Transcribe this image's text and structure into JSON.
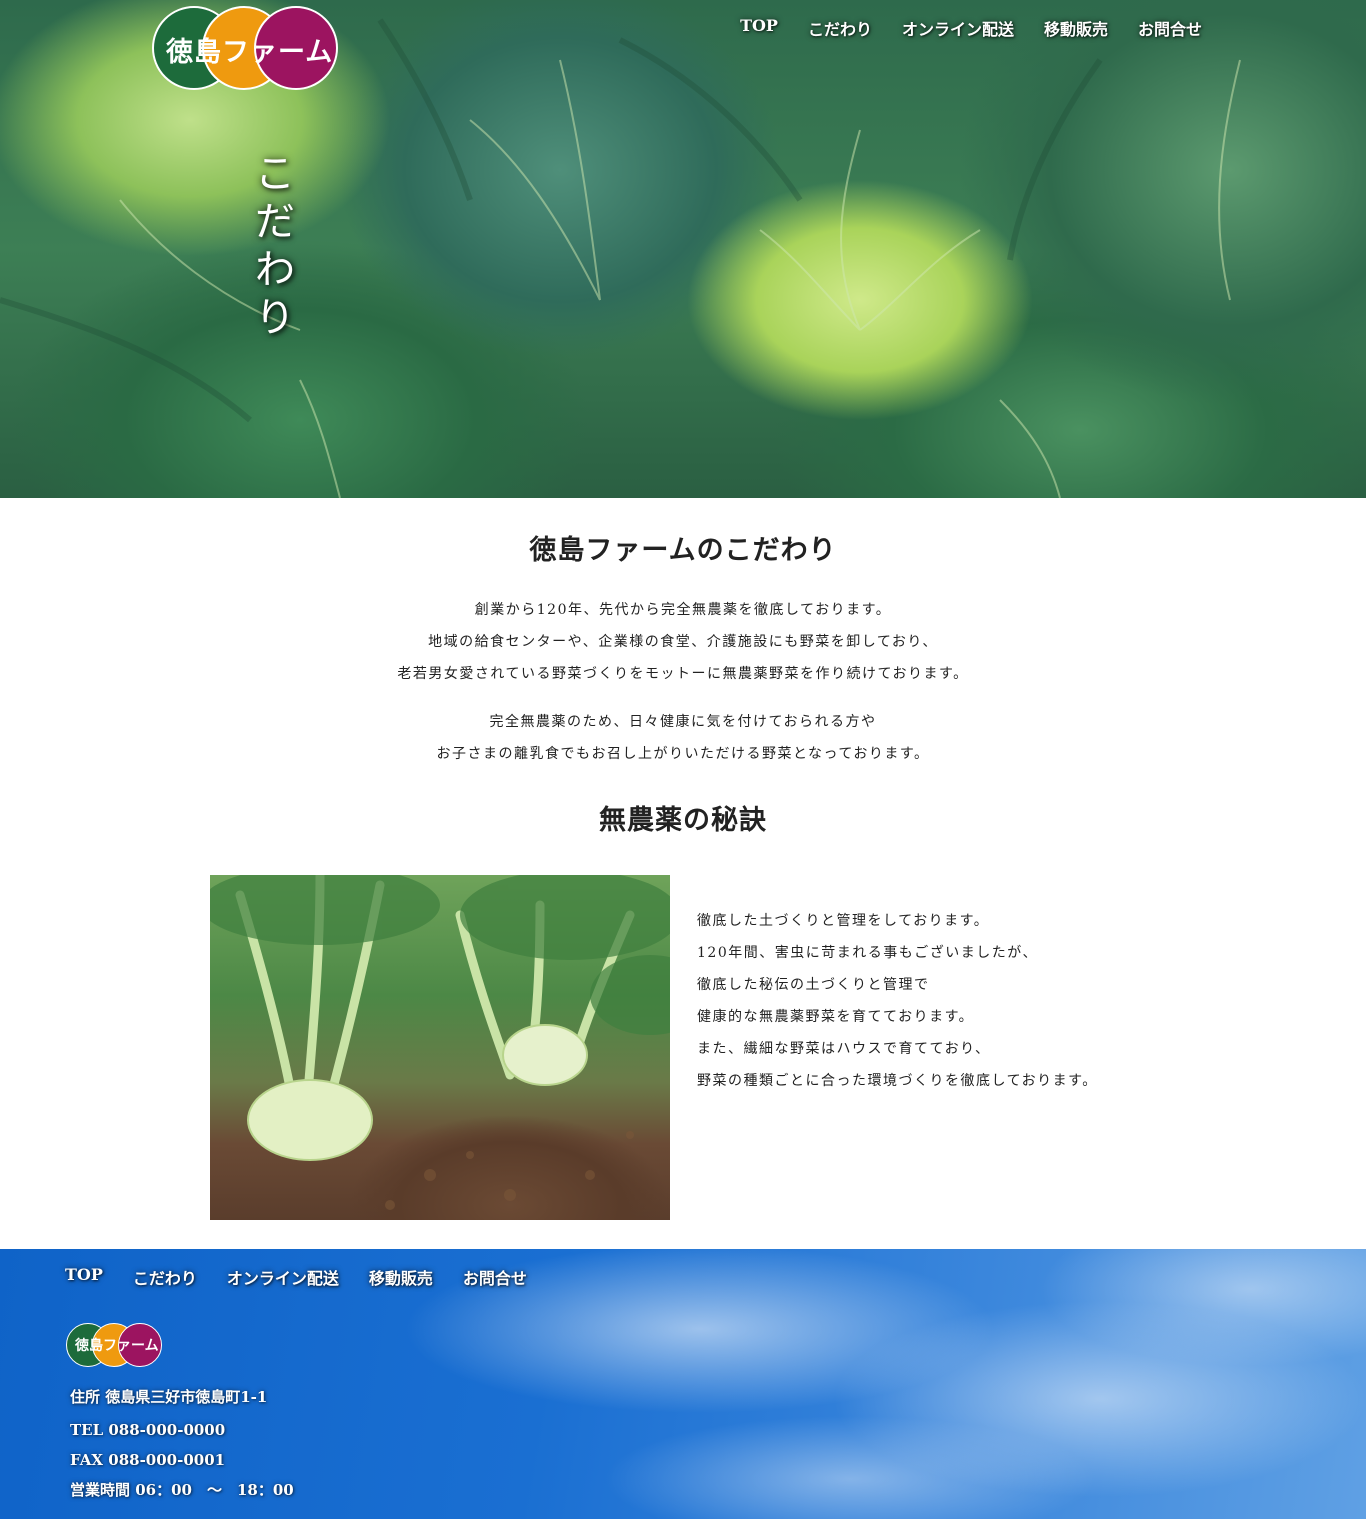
{
  "brand": {
    "logo_text": "徳島ファーム",
    "colors": [
      "#1d6b3b",
      "#ef9a0f",
      "#9c1460"
    ]
  },
  "nav": [
    "TOP",
    "こだわり",
    "オンライン配送",
    "移動販売",
    "お問合せ"
  ],
  "hero": {
    "title_chars": [
      "こ",
      "だ",
      "わ",
      "り"
    ]
  },
  "intro": {
    "heading": "徳島ファームのこだわり",
    "para1": [
      "創業から120年、先代から完全無農薬を徹底しております。",
      "地域の給食センターや、企業様の食堂、介護施設にも野菜を卸しており、",
      "老若男女愛されている野菜づくりをモットーに無農薬野菜を作り続けております。"
    ],
    "para2": [
      "完全無農薬のため、日々健康に気を付けておられる方や",
      "お子さまの離乳食でもお召し上がりいただける野菜となっております。"
    ]
  },
  "secret": {
    "heading": "無農薬の秘訣",
    "lines": [
      "徹底した土づくりと管理をしております。",
      "120年間、害虫に苛まれる事もございましたが、",
      "徹底した秘伝の土づくりと管理で",
      "健康的な無農薬野菜を育てております。",
      "また、繊細な野菜はハウスで育てており、",
      "野菜の種類ごとに合った環境づくりを徹底しております。"
    ]
  },
  "footer": {
    "nav": [
      "TOP",
      "こだわり",
      "オンライン配送",
      "移動販売",
      "お問合せ"
    ],
    "address": "住所 徳島県三好市徳島町1-1",
    "tel": "TEL 088-000-0000",
    "fax": "FAX 088-000-0001",
    "hours": "営業時間 06：00　～　18：00"
  }
}
